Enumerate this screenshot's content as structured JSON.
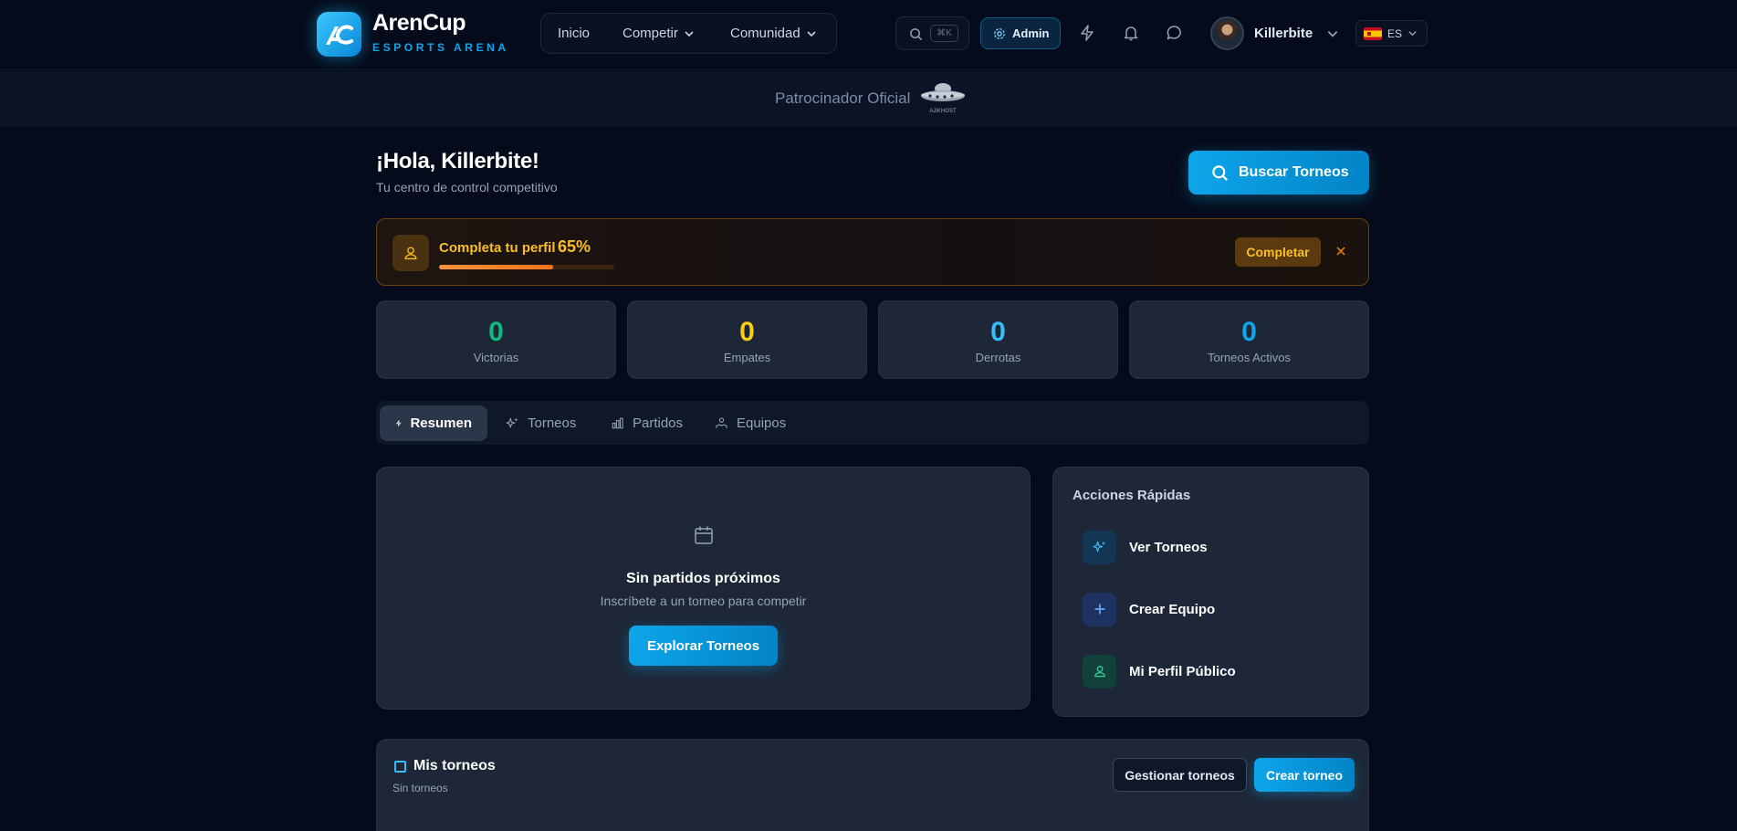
{
  "brand": {
    "name": "ArenCup",
    "subtitle": "ESPORTS ARENA"
  },
  "nav": {
    "items": [
      {
        "label": "Inicio"
      },
      {
        "label": "Competir"
      },
      {
        "label": "Comunidad"
      }
    ]
  },
  "search": {
    "shortcut": "⌘K"
  },
  "admin": {
    "label": "Admin"
  },
  "user": {
    "name": "Killerbite"
  },
  "language": {
    "code": "ES"
  },
  "sponsor": {
    "label": "Patrocinador Oficial",
    "logo_text": "AJIKHOST"
  },
  "greeting": {
    "title": "¡Hola, Killerbite!",
    "subtitle": "Tu centro de control competitivo",
    "search_button": "Buscar Torneos"
  },
  "profile_completion": {
    "title": "Completa tu perfil",
    "percent_label": "65%",
    "percent": 65,
    "button": "Completar"
  },
  "stats": [
    {
      "value": "0",
      "label": "Victorias",
      "color": "#10b981"
    },
    {
      "value": "0",
      "label": "Empates",
      "color": "#facc15"
    },
    {
      "value": "0",
      "label": "Derrotas",
      "color": "#38bdf8"
    },
    {
      "value": "0",
      "label": "Torneos Activos",
      "color": "#0ea5e9"
    }
  ],
  "tabs": [
    {
      "label": "Resumen",
      "active": true
    },
    {
      "label": "Torneos"
    },
    {
      "label": "Partidos"
    },
    {
      "label": "Equipos"
    }
  ],
  "matches": {
    "title": "Sin partidos próximos",
    "subtitle": "Inscríbete a un torneo para competir",
    "button": "Explorar Torneos"
  },
  "quick_actions": {
    "title": "Acciones Rápidas",
    "items": [
      {
        "label": "Ver Torneos",
        "icon": "sparkles-icon",
        "color": "#38bdf8"
      },
      {
        "label": "Crear Equipo",
        "icon": "plus-icon",
        "color": "#60a5fa"
      },
      {
        "label": "Mi Perfil Público",
        "icon": "user-icon",
        "color": "#34d399"
      }
    ]
  },
  "my_tournaments": {
    "title": "Mis torneos",
    "subtitle": "Sin torneos",
    "manage_button": "Gestionar torneos",
    "create_button": "Crear torneo"
  }
}
